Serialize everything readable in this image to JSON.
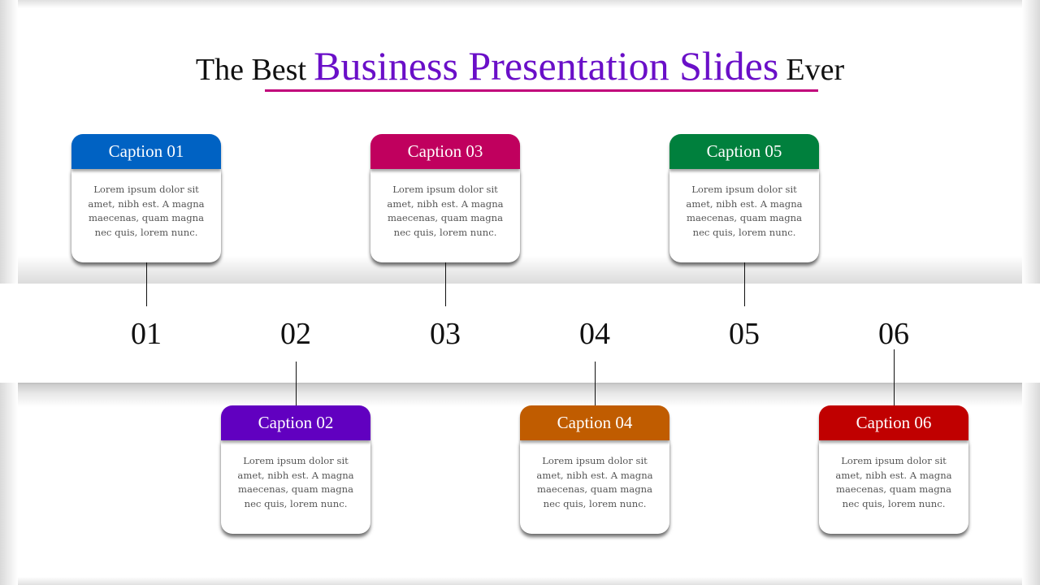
{
  "title": {
    "prefix": "The Best",
    "highlight": "Business Presentation Slides",
    "suffix": "Ever"
  },
  "colors": {
    "highlight_text": "#6a0fc8",
    "underline": "#c0007a"
  },
  "steps": [
    {
      "number": "01",
      "caption": "Caption 01",
      "text": "Lorem ipsum dolor sit amet, nibh est. A magna maecenas, quam magna nec quis, lorem nunc.",
      "color": "#0062c3",
      "position": "top"
    },
    {
      "number": "02",
      "caption": "Caption 02",
      "text": "Lorem ipsum dolor sit amet, nibh est. A magna maecenas, quam magna nec quis, lorem nunc.",
      "color": "#6100c0",
      "position": "bottom"
    },
    {
      "number": "03",
      "caption": "Caption 03",
      "text": "Lorem ipsum dolor sit amet, nibh est. A magna maecenas, quam magna nec quis, lorem nunc.",
      "color": "#c0005e",
      "position": "top"
    },
    {
      "number": "04",
      "caption": "Caption 04",
      "text": "Lorem ipsum dolor sit amet, nibh est. A magna maecenas, quam magna nec quis, lorem nunc.",
      "color": "#c05c00",
      "position": "bottom"
    },
    {
      "number": "05",
      "caption": "Caption 05",
      "text": "Lorem ipsum dolor sit amet, nibh est. A magna maecenas, quam magna nec quis, lorem nunc.",
      "color": "#00803d",
      "position": "top"
    },
    {
      "number": "06",
      "caption": "Caption 06",
      "text": "Lorem ipsum dolor sit amet, nibh est. A magna maecenas, quam magna nec quis, lorem nunc.",
      "color": "#c00000",
      "position": "bottom"
    }
  ]
}
